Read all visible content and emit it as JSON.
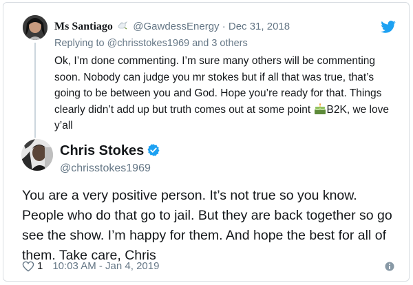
{
  "parent_tweet": {
    "display_name": "Ms Santiago",
    "handle": "@GawdessEnergy",
    "separator": "·",
    "date": "Dec 31, 2018",
    "reply_prefix": "Replying to",
    "reply_mention": "@chrisstokes1969",
    "reply_suffix": "and 3 others",
    "text_main": "Ok, I’m done commenting. I’m sure many others will be commenting soon. Nobody can judge you mr stokes but if all that was true, that’s going to be between you and God. Hope you’re ready for that. Things clearly didn’t add up but truth comes out at some point",
    "text_after_emoji": "B2K, we love y’all",
    "name_emoji_icon": "dove-icon",
    "inline_emoji_icon": "birthday-cake-icon"
  },
  "main_tweet": {
    "display_name": "Chris Stokes",
    "handle": "@chrisstokes1969",
    "verified": true,
    "text": "You are a very positive person. It’s not true so you know. People who do that go to jail. But they are back together so go see the show. I’m happy for them. And hope the best for all of them. Take care, Chris",
    "like_count": "1",
    "timestamp": "10:03 AM - Jan 4, 2019"
  },
  "colors": {
    "twitter_blue": "#1da1f2",
    "text_primary": "#14171a",
    "text_secondary": "#657786",
    "border": "#d8dde2"
  }
}
